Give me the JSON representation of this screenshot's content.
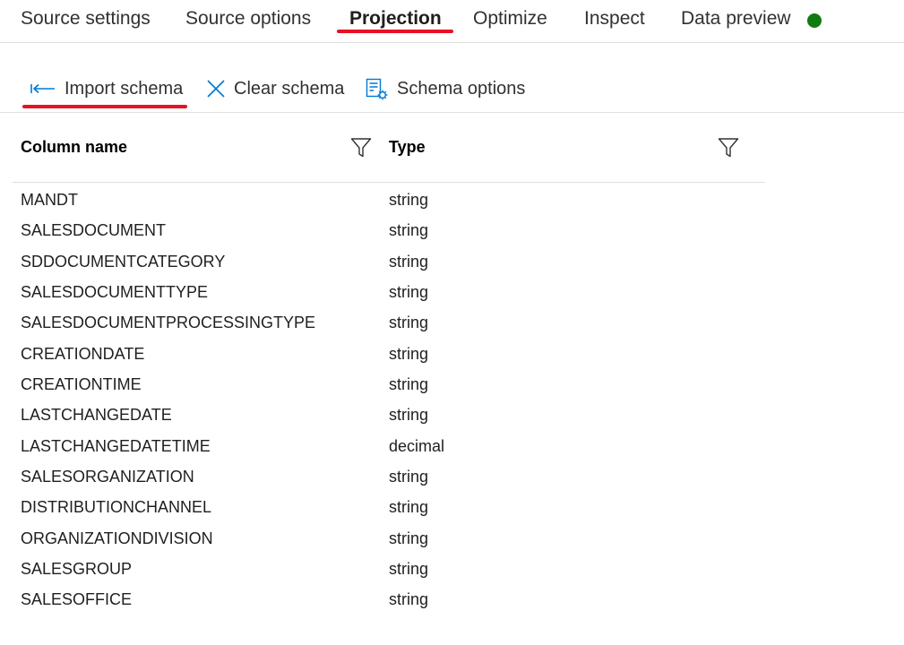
{
  "tabs": [
    {
      "label": "Source settings",
      "active": false
    },
    {
      "label": "Source options",
      "active": false
    },
    {
      "label": "Projection",
      "active": true
    },
    {
      "label": "Optimize",
      "active": false
    },
    {
      "label": "Inspect",
      "active": false
    },
    {
      "label": "Data preview",
      "active": false
    }
  ],
  "status": {
    "color": "#107c10",
    "icon": "status-dot-green"
  },
  "toolbar": {
    "import_schema": "Import schema",
    "clear_schema": "Clear schema",
    "schema_options": "Schema options"
  },
  "grid": {
    "columns": [
      "Column name",
      "Type"
    ],
    "rows": [
      {
        "name": "MANDT",
        "type": "string"
      },
      {
        "name": "SALESDOCUMENT",
        "type": "string"
      },
      {
        "name": "SDDOCUMENTCATEGORY",
        "type": "string"
      },
      {
        "name": "SALESDOCUMENTTYPE",
        "type": "string"
      },
      {
        "name": "SALESDOCUMENTPROCESSINGTYPE",
        "type": "string"
      },
      {
        "name": "CREATIONDATE",
        "type": "string"
      },
      {
        "name": "CREATIONTIME",
        "type": "string"
      },
      {
        "name": "LASTCHANGEDATE",
        "type": "string"
      },
      {
        "name": "LASTCHANGEDATETIME",
        "type": "decimal"
      },
      {
        "name": "SALESORGANIZATION",
        "type": "string"
      },
      {
        "name": "DISTRIBUTIONCHANNEL",
        "type": "string"
      },
      {
        "name": "ORGANIZATIONDIVISION",
        "type": "string"
      },
      {
        "name": "SALESGROUP",
        "type": "string"
      },
      {
        "name": "SALESOFFICE",
        "type": "string"
      }
    ]
  },
  "colors": {
    "accent": "#0078d4",
    "annotation": "#e81123"
  }
}
